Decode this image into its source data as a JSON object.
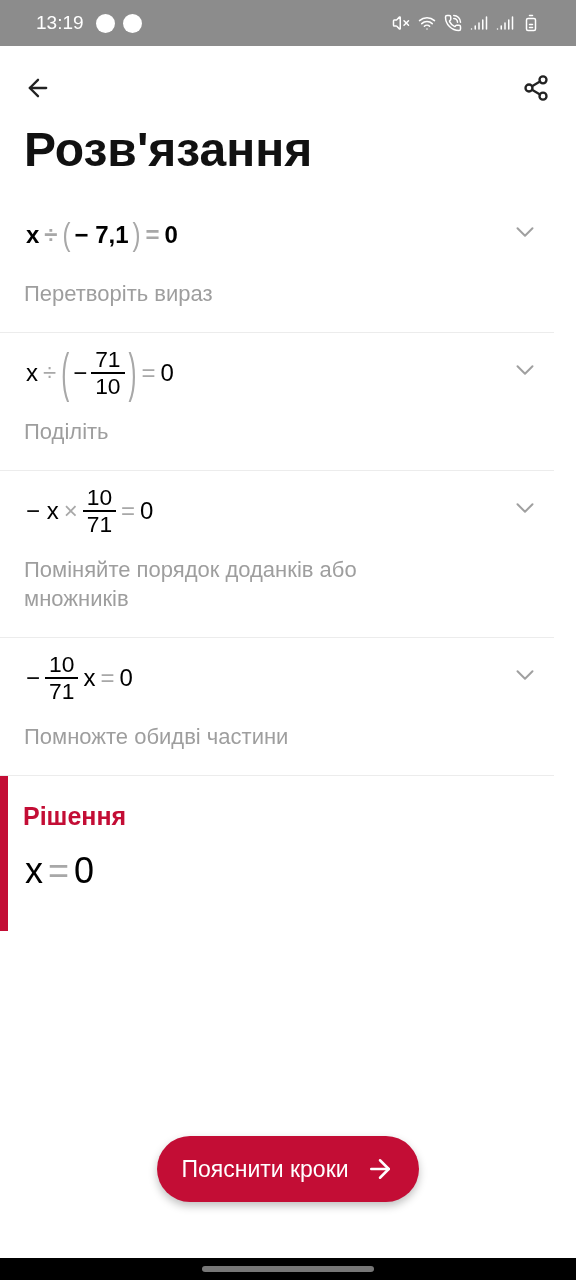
{
  "status_bar": {
    "time": "13:19"
  },
  "header": {
    "title": "Розв'язання"
  },
  "steps": [
    {
      "bold": true,
      "expanded": false,
      "expression": [
        {
          "kind": "sym",
          "text": "x"
        },
        {
          "kind": "op",
          "text": "÷"
        },
        {
          "kind": "paren",
          "open": "(",
          "close": ")",
          "children": [
            {
              "kind": "sym",
              "text": "− 7,1"
            }
          ]
        },
        {
          "kind": "op",
          "text": "="
        },
        {
          "kind": "sym",
          "text": "0"
        }
      ],
      "description": "Перетворіть вираз"
    },
    {
      "bold": false,
      "expanded": false,
      "expression": [
        {
          "kind": "sym",
          "text": "x"
        },
        {
          "kind": "op",
          "text": "÷"
        },
        {
          "kind": "paren",
          "open": "(",
          "close": ")",
          "children": [
            {
              "kind": "sym",
              "text": "−"
            },
            {
              "kind": "frac",
              "num": "71",
              "den": "10"
            }
          ]
        },
        {
          "kind": "op",
          "text": "="
        },
        {
          "kind": "sym",
          "text": "0"
        }
      ],
      "description": "Поділіть"
    },
    {
      "bold": false,
      "expanded": false,
      "expression": [
        {
          "kind": "sym",
          "text": "− x"
        },
        {
          "kind": "op",
          "text": "×"
        },
        {
          "kind": "frac",
          "num": "10",
          "den": "71"
        },
        {
          "kind": "op",
          "text": "="
        },
        {
          "kind": "sym",
          "text": "0"
        }
      ],
      "description": "Поміняйте порядок доданків або множників"
    },
    {
      "bold": false,
      "expanded": false,
      "expression": [
        {
          "kind": "sym",
          "text": "−"
        },
        {
          "kind": "frac",
          "num": "10",
          "den": "71"
        },
        {
          "kind": "sym",
          "text": "x"
        },
        {
          "kind": "op",
          "text": "="
        },
        {
          "kind": "sym",
          "text": "0"
        }
      ],
      "description": "Помножте обидві частини"
    }
  ],
  "solution": {
    "label": "Рішення",
    "expression": [
      {
        "kind": "sym",
        "text": "x"
      },
      {
        "kind": "op",
        "text": "="
      },
      {
        "kind": "sym",
        "text": "0"
      }
    ]
  },
  "action_button": {
    "label": "Пояснити кроки"
  }
}
